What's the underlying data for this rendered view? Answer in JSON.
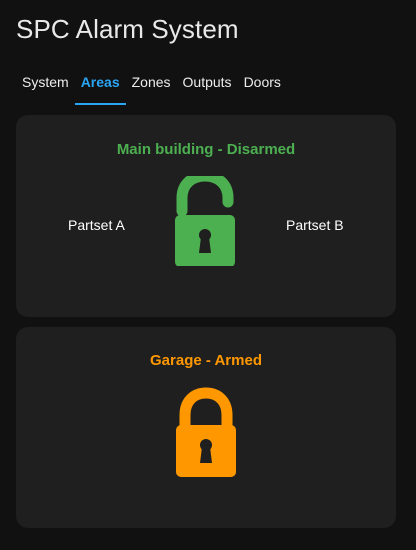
{
  "app": {
    "title": "SPC Alarm System"
  },
  "tabs": [
    {
      "label": "System",
      "active": false
    },
    {
      "label": "Areas",
      "active": true
    },
    {
      "label": "Zones",
      "active": false
    },
    {
      "label": "Outputs",
      "active": false
    },
    {
      "label": "Doors",
      "active": false
    }
  ],
  "areas": [
    {
      "title": "Main building - Disarmed",
      "status": "disarmed",
      "color": "#4caf50",
      "icon": "lock-open-icon",
      "partsets": [
        "Partset A",
        "Partset B"
      ]
    },
    {
      "title": "Garage - Armed",
      "status": "armed",
      "color": "#ff9800",
      "icon": "lock-closed-icon"
    }
  ],
  "colors": {
    "background": "#111111",
    "card": "#1f1f1f",
    "accent": "#2aa5f3"
  }
}
